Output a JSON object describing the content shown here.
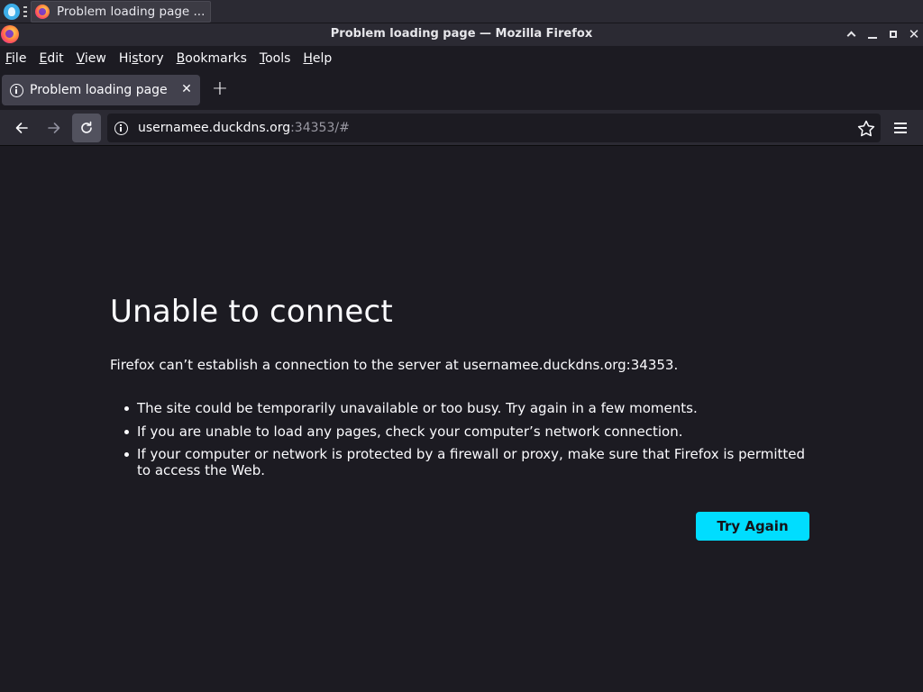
{
  "taskbar": {
    "task_label": "Problem loading page ..."
  },
  "window": {
    "title": "Problem loading page — Mozilla Firefox"
  },
  "menu": {
    "items": [
      {
        "label": "File",
        "accel": "F",
        "rest": "ile"
      },
      {
        "label": "Edit",
        "accel": "E",
        "rest": "dit"
      },
      {
        "label": "View",
        "accel": "V",
        "rest": "iew"
      },
      {
        "label": "History",
        "pre": "Hi",
        "accel": "s",
        "rest": "tory"
      },
      {
        "label": "Bookmarks",
        "accel": "B",
        "rest": "ookmarks"
      },
      {
        "label": "Tools",
        "accel": "T",
        "rest": "ools"
      },
      {
        "label": "Help",
        "accel": "H",
        "rest": "elp"
      }
    ]
  },
  "tabs": [
    {
      "label": "Problem loading page",
      "active": true
    }
  ],
  "urlbar": {
    "host": "usernamee.duckdns.org",
    "rest": ":34353/#"
  },
  "error": {
    "title": "Unable to connect",
    "description": "Firefox can’t establish a connection to the server at usernamee.duckdns.org:34353.",
    "bullets": [
      "The site could be temporarily unavailable or too busy. Try again in a few moments.",
      "If you are unable to load any pages, check your computer’s network connection.",
      "If your computer or network is protected by a firewall or proxy, make sure that Firefox is permitted to access the Web."
    ],
    "button": "Try Again"
  },
  "colors": {
    "accent": "#00ddff",
    "background": "#1c1b22",
    "toolbar": "#2b2a33"
  }
}
